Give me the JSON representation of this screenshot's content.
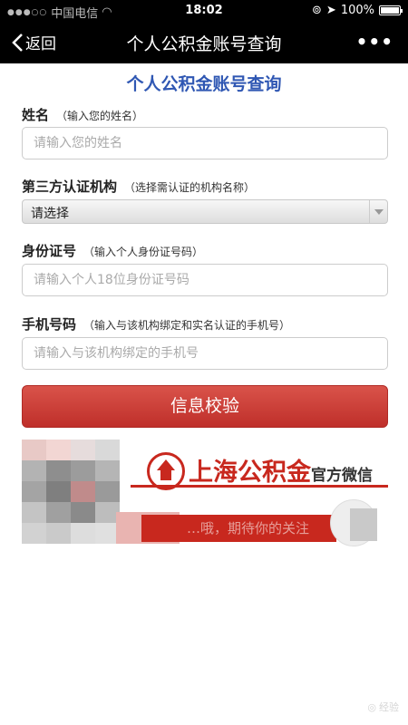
{
  "status_bar": {
    "carrier": "中国电信",
    "time": "18:02",
    "battery": "100%",
    "battery_level": 1.0
  },
  "nav": {
    "back_label": "返回",
    "title": "个人公积金账号查询",
    "more_label": "•••"
  },
  "page_heading": "个人公积金账号查询",
  "form": {
    "name": {
      "label": "姓名",
      "hint": "（输入您的姓名）",
      "placeholder": "请输入您的姓名"
    },
    "org": {
      "label": "第三方认证机构",
      "hint": "（选择需认证的机构名称）",
      "value": "请选择"
    },
    "id_number": {
      "label": "身份证号",
      "hint": "（输入个人身份证号码）",
      "placeholder": "请输入个人18位身份证号码"
    },
    "phone": {
      "label": "手机号码",
      "hint": "（输入与该机构绑定和实名认证的手机号）",
      "placeholder": "请输入与该机构绑定的手机号"
    },
    "submit_label": "信息校验"
  },
  "banner": {
    "logo_text": "上海公积金",
    "logo_suffix": "官方微信",
    "strip_text": "…哦，期待你的关注"
  },
  "colors": {
    "brand_red": "#c8281e",
    "heading_blue": "#2f57b3"
  }
}
